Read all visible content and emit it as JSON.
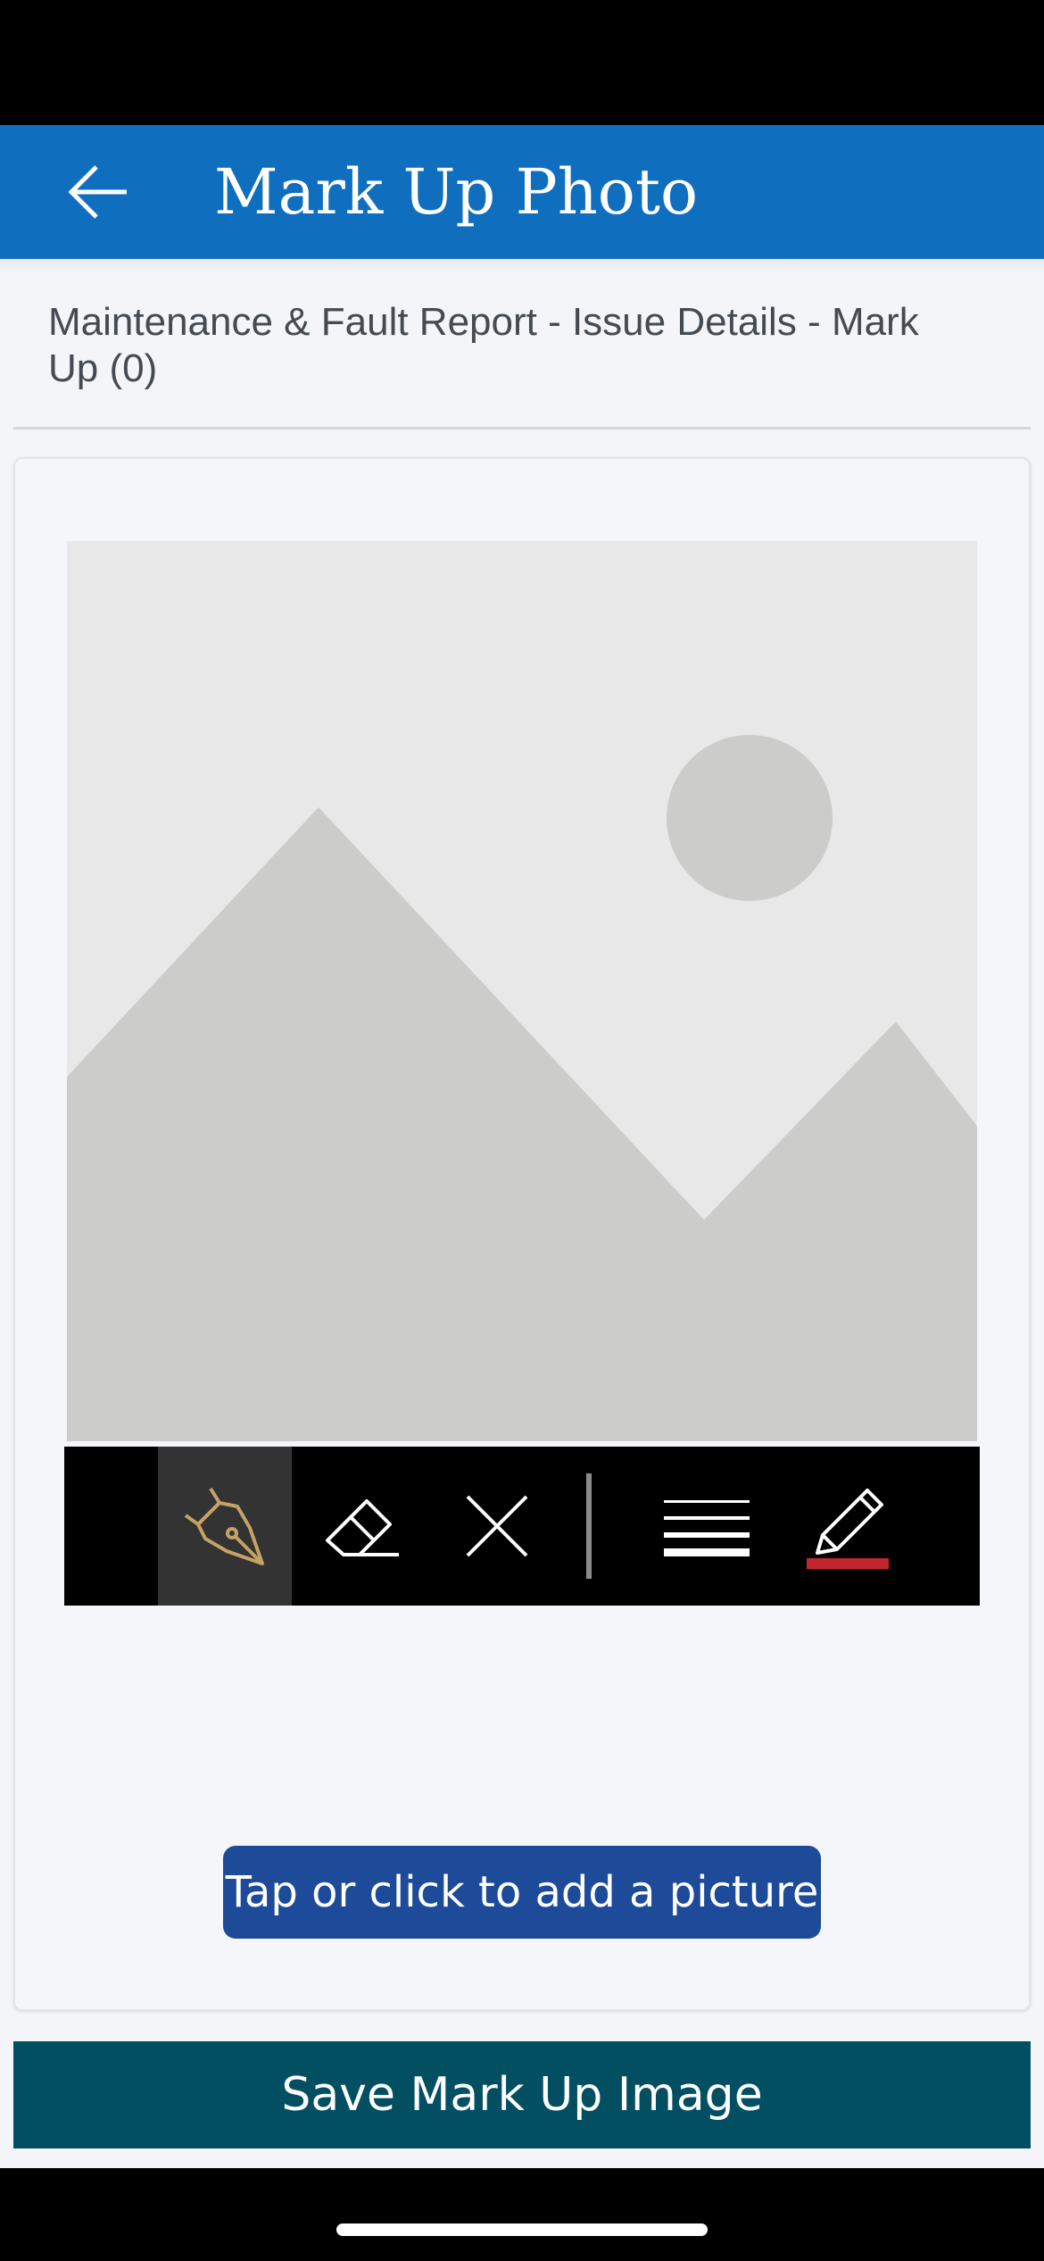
{
  "header": {
    "title": "Mark Up Photo",
    "back_icon": "arrow-left-icon",
    "background": "#106ebe"
  },
  "breadcrumb": "Maintenance & Fault Report - Issue Details - Mark Up (0)",
  "image": {
    "icon": "image-placeholder-icon"
  },
  "toolbar": {
    "tools": [
      {
        "name": "pen-tool",
        "icon": "pen-nib-icon",
        "active": true,
        "color": "#c6a266"
      },
      {
        "name": "eraser-tool",
        "icon": "eraser-icon",
        "active": false
      },
      {
        "name": "clear-tool",
        "icon": "close-icon",
        "active": false
      },
      {
        "name": "line-width-tool",
        "icon": "line-weight-icon",
        "active": false
      },
      {
        "name": "color-tool",
        "icon": "pencil-color-icon",
        "active": false,
        "color": "#c2262e"
      }
    ]
  },
  "add_picture_label": "Tap or click to add a picture",
  "save_label": "Save Mark Up Image",
  "colors": {
    "accent": "#106ebe",
    "add_button": "#1d4b9a",
    "save_button": "#034f62"
  }
}
